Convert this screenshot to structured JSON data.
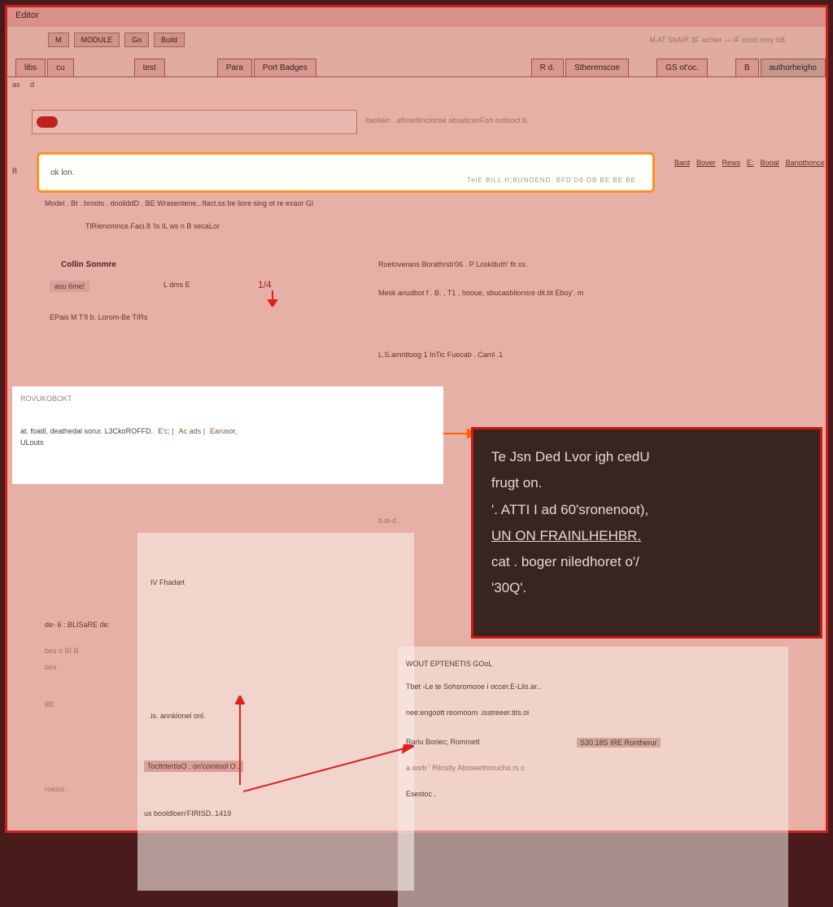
{
  "titlebar": {
    "text": "Editor"
  },
  "toolbar": {
    "b1": "M",
    "b2": "MODULE",
    "b3": "Go",
    "b4": "Build"
  },
  "tabs": [
    {
      "label": "libs",
      "active": false
    },
    {
      "label": "cu",
      "active": false
    },
    {
      "label": "test",
      "active": false
    },
    {
      "label": "Para",
      "active": false
    },
    {
      "label": "Port Badges",
      "active": false
    },
    {
      "label": "R d.",
      "active": false
    },
    {
      "label": "Stherenscoe",
      "active": false
    },
    {
      "label": "GS ot'oc.",
      "active": false
    },
    {
      "label": "B",
      "active": false
    },
    {
      "label": "authorheigho",
      "active": true
    }
  ],
  "sidebar": {
    "col1": "as",
    "col2": "d",
    "ln3": "B"
  },
  "panel1": {
    "text": ""
  },
  "status_right": "Itaollain   . aflinedlinclorise absaticeoFort outloocl:6.",
  "highlight": {
    "text": "ok lon.",
    "right": "TelE   BILL  H;BUNOEND.  BFD'D6 OB BE BE BE"
  },
  "subnav": [
    "Bard",
    "Bover",
    "Rews",
    "E:",
    "Booal",
    "Banothonce"
  ],
  "lines": {
    "l1": "Model .  Bt .  broots . dooliddD . BE  Wrasentene...flact.ss be  liore sing ot re exaor Gl",
    "l2": "TlRienomnce.Faci.8 'Is  IL ws   n   B  secaLor",
    "sec1": "Collin Sonmre",
    "l3a": "asu 6me!",
    "l3b": "L dms E",
    "l3c": "1/4",
    "l4": "EPais   M   T'll b.   Lorom-Be TIRs",
    "r1": "Roetoverans Borathrsb'06 . P  Loskitiuth' flr.xs.",
    "r2": "Mesk anudbot f .    B. , T1 ,   hooue, sbucasblionsre    dit.bt Eboy'.   m",
    "r3": "L.S.amntloog 1    InTic   Fuecab . Caml .1",
    "l5": "at.  foatil, deathedal sorur.  L3CkoROFFD.        E'c; |     Ac ads |     Earusor,",
    "l6": "ULouts"
  },
  "white_panel": {
    "hdr": "ROVUKOBOKT",
    "row1": "at.  foatil, deathedal sorur.  L3CkoROFFD.",
    "row1b": "E'c; |",
    "row1c": "Ac ads |",
    "row1d": "Earusor,",
    "row2": "ULouts"
  },
  "callout": {
    "l1": "Te Jsn Ded Lvor igh cedU",
    "l2": "frugt on.",
    "l3": "'. ATTI I ad 60'sronenoot),",
    "l4": "UN ON FRAINLHEHBR.",
    "l5": "cat   .  boger niledhoret o'/",
    "l6": "'30Q'."
  },
  "doc_lines": {
    "d0": "b.sl-d .",
    "d1": "IV    Fhadart",
    "d2": "de- 6  :    BLISaRE de:",
    "d3": "bes   n BI  B",
    "d4": "bes",
    "d5": "BE",
    "d6": ".is. annklonel onl.",
    "d7": "TocttrtertisO . on'comtool O .",
    "d8": "roesci .",
    "d9": "us booldloen'FIRISD..1419",
    "r_d1": "WOUT EPTENETIS GOoL",
    "r_d2": "Tbet -Le te Sohsromooe    i occer.E-Llis.ar..",
    "r_d3": "nee:engoott reomoorn  .isstreeer.tits.oi",
    "r_d4": "Rariu Boriec;  Rommetl",
    "r_d4b": "S30.18S IRE Rontherur",
    "r_d5": "a oorb    ' Rilostly   Aboseethorucho.rs  c",
    "r_d6": "Esestoc ."
  },
  "colors": {
    "accent": "#cc2020",
    "highlight": "#ff9020",
    "callout_bg": "#3a2420"
  }
}
